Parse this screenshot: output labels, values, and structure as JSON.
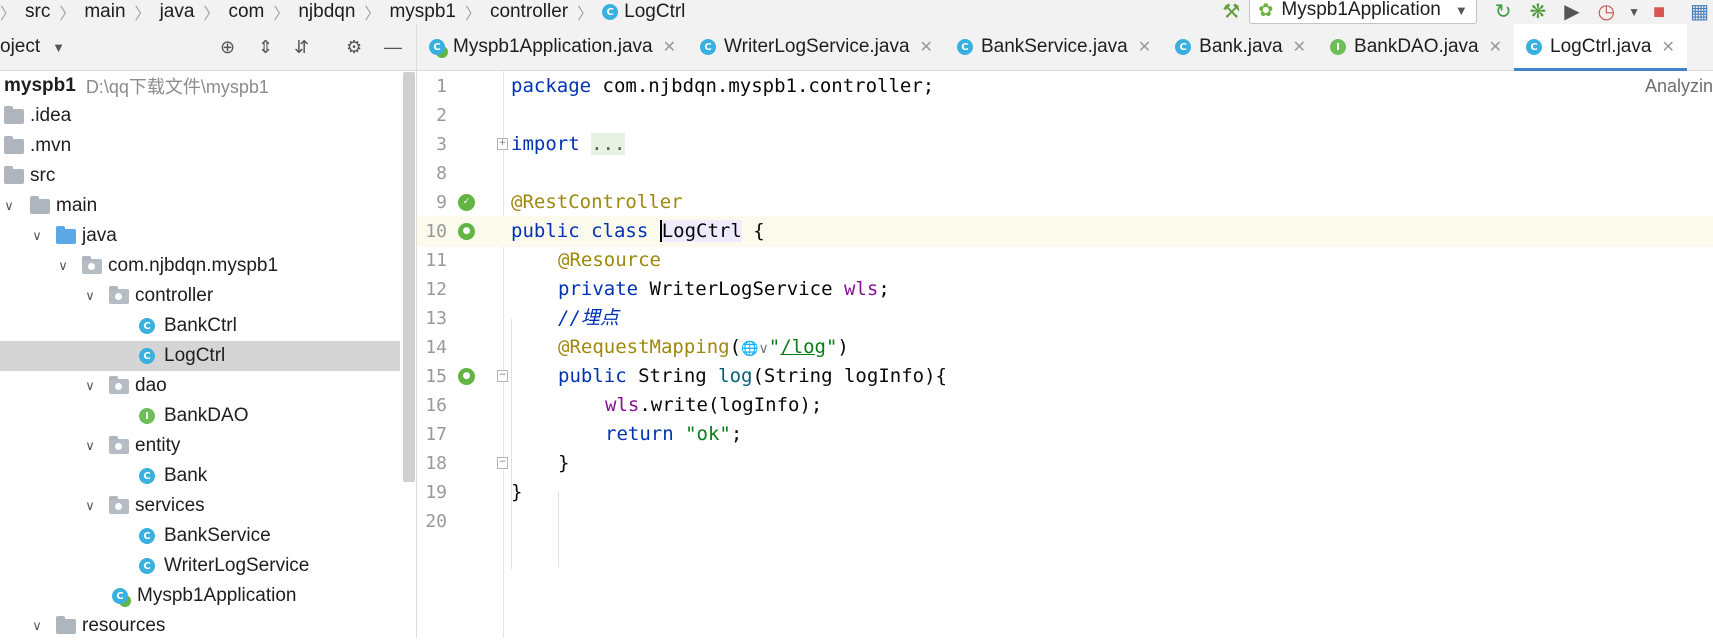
{
  "navbar": {
    "crumbs": [
      "src",
      "main",
      "java",
      "com",
      "njbdqn",
      "myspb1",
      "controller",
      "LogCtrl"
    ],
    "run_config": "Myspb1Application"
  },
  "project": {
    "title": "oject",
    "root_name": "myspb1",
    "root_path": "D:\\qq下载文件\\myspb1",
    "tree": [
      {
        "label": ".idea",
        "kind": "folder"
      },
      {
        "label": ".mvn",
        "kind": "folder"
      },
      {
        "label": "src",
        "kind": "folder"
      },
      {
        "label": "main",
        "kind": "folder"
      },
      {
        "label": "java",
        "kind": "folder-blue"
      },
      {
        "label": "com.njbdqn.myspb1",
        "kind": "package"
      },
      {
        "label": "controller",
        "kind": "package"
      },
      {
        "label": "BankCtrl",
        "kind": "class"
      },
      {
        "label": "LogCtrl",
        "kind": "class"
      },
      {
        "label": "dao",
        "kind": "package"
      },
      {
        "label": "BankDAO",
        "kind": "interface"
      },
      {
        "label": "entity",
        "kind": "package"
      },
      {
        "label": "Bank",
        "kind": "class"
      },
      {
        "label": "services",
        "kind": "package"
      },
      {
        "label": "BankService",
        "kind": "class"
      },
      {
        "label": "WriterLogService",
        "kind": "class"
      },
      {
        "label": "Myspb1Application",
        "kind": "spring-class"
      },
      {
        "label": "resources",
        "kind": "folder"
      }
    ]
  },
  "tabs": [
    {
      "label": "Myspb1Application.java",
      "icon": "C"
    },
    {
      "label": "WriterLogService.java",
      "icon": "C"
    },
    {
      "label": "BankService.java",
      "icon": "C"
    },
    {
      "label": "Bank.java",
      "icon": "C"
    },
    {
      "label": "BankDAO.java",
      "icon": "I"
    },
    {
      "label": "LogCtrl.java",
      "icon": "C"
    }
  ],
  "editor": {
    "status": "Analyzin",
    "line_numbers": [
      "1",
      "2",
      "3",
      "8",
      "9",
      "10",
      "11",
      "12",
      "13",
      "14",
      "15",
      "16",
      "17",
      "18",
      "19",
      "20"
    ],
    "code": {
      "l1_kw": "package",
      "l1_rest": " com.njbdqn.myspb1.controller;",
      "l3_kw": "import",
      "l3_fold": "...",
      "l9_ann": "@RestController",
      "l10_kw": "public class",
      "l10_name": "LogCtrl",
      "l10_rest": " {",
      "l11_ann": "@Resource",
      "l12_kw": "private",
      "l12_type": " WriterLogService ",
      "l12_field": "wls",
      "l12_end": ";",
      "l13_cmt": "//",
      "l13_cjk": "埋点",
      "l14_ann": "@RequestMapping",
      "l14_open": "(",
      "l14_q1": "\"",
      "l14_path": "/log",
      "l14_q2": "\"",
      "l14_close": ")",
      "l15_kw": "public",
      "l15_type": " String ",
      "l15_method": "log",
      "l15_rest": "(String logInfo){",
      "l16_field": "wls",
      "l16_rest": ".write(logInfo);",
      "l17_kw": "return",
      "l17_sp": " ",
      "l17_str": "\"ok\"",
      "l17_end": ";",
      "l18": "}",
      "l19": "}"
    }
  },
  "colors": {
    "keyword": "#0033b3",
    "annotation": "#9e880d",
    "field": "#871094",
    "string": "#067d17",
    "active_tab_underline": "#4083c9"
  }
}
